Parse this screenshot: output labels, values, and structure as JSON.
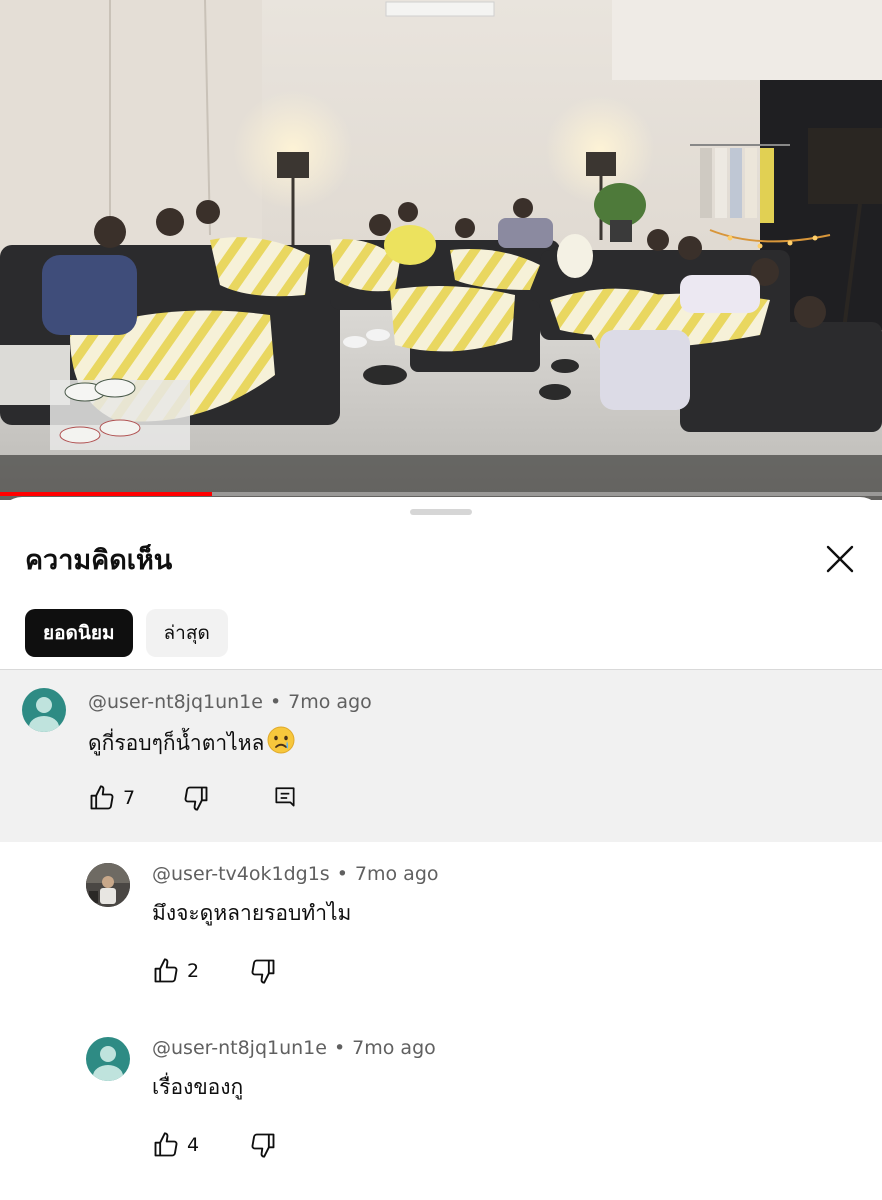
{
  "video": {
    "progress_fraction": 0.24
  },
  "sheet": {
    "title": "ความคิดเห็น",
    "close_icon": "close-icon"
  },
  "sort_chips": {
    "top_label": "ยอดนิยม",
    "newest_label": "ล่าสุด"
  },
  "comments": [
    {
      "handle": "@user-nt8jq1un1e",
      "separator": "•",
      "time": "7mo ago",
      "text": "ดูกี่รอบๆก็น้ำตาไหล",
      "emoji": "😢",
      "likes": "7",
      "avatar": "default-avatar-icon"
    },
    {
      "handle": "@user-tv4ok1dg1s",
      "separator": "•",
      "time": "7mo ago",
      "text": "มึงจะดูหลายรอบทำไม",
      "likes": "2",
      "avatar": "photo-avatar"
    },
    {
      "handle": "@user-nt8jq1un1e",
      "separator": "•",
      "time": "7mo ago",
      "text": "เรื่องของกู",
      "likes": "4",
      "avatar": "default-avatar-icon"
    }
  ],
  "colors": {
    "accent_red": "#ff0000",
    "avatar_teal": "#2e8b84",
    "highlight_bg": "#f1f1f1",
    "chip_active_bg": "#0f0f0f",
    "chip_inactive_bg": "#f2f2f2"
  }
}
